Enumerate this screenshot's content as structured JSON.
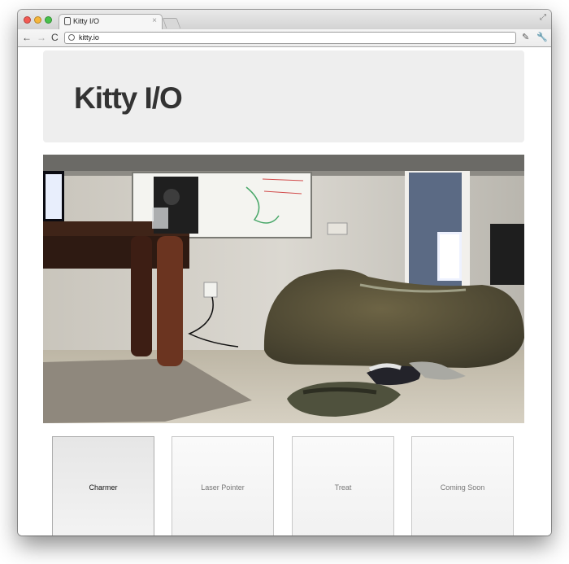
{
  "browser": {
    "tab_title": "Kitty I/O",
    "tab_close": "×",
    "url": "kitty.io",
    "back_icon": "←",
    "forward_icon": "→",
    "reload_icon": "C",
    "fullscreen_icon": "⤢",
    "ext_icon_1": "✎",
    "ext_icon_2": "🔧"
  },
  "page": {
    "title": "Kitty I/O"
  },
  "controls": [
    {
      "label": "Charmer",
      "active": true
    },
    {
      "label": "Laser Pointer",
      "active": false
    },
    {
      "label": "Treat",
      "active": false
    },
    {
      "label": "Coming Soon",
      "active": false
    }
  ]
}
